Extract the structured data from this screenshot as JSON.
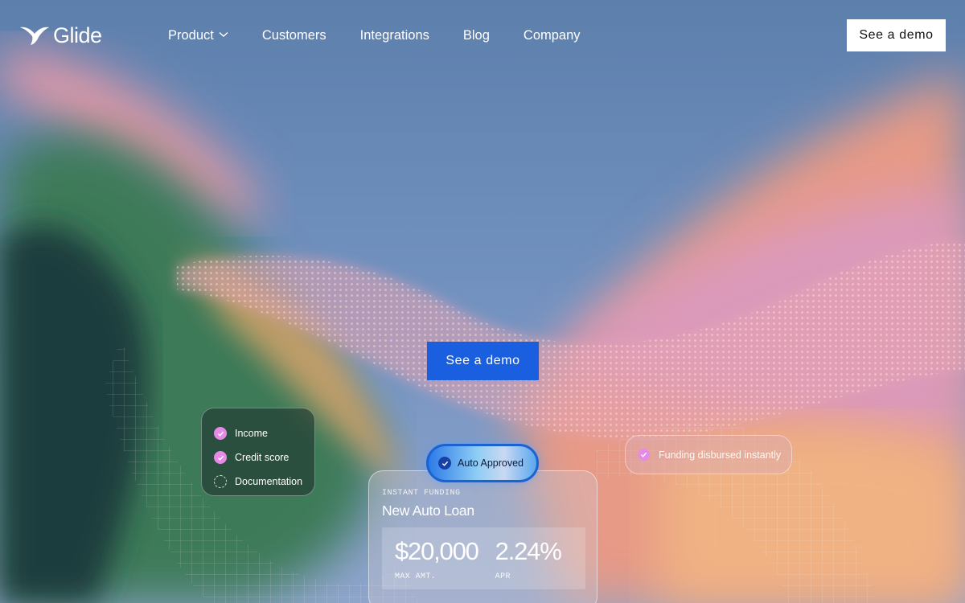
{
  "brand": {
    "name": "Glide",
    "icon": "glide-bird-icon"
  },
  "nav": {
    "links": [
      {
        "label": "Product",
        "has_dropdown": true
      },
      {
        "label": "Customers"
      },
      {
        "label": "Integrations"
      },
      {
        "label": "Blog"
      },
      {
        "label": "Company"
      }
    ],
    "cta_label": "See a demo"
  },
  "hero": {
    "cta_label": "See a demo"
  },
  "checklist": {
    "items": [
      {
        "label": "Income",
        "status": "done"
      },
      {
        "label": "Credit score",
        "status": "done"
      },
      {
        "label": "Documentation",
        "status": "pending"
      }
    ]
  },
  "status_pill": {
    "label": "Auto Approved"
  },
  "toast": {
    "label": "Funding disbursed instantly"
  },
  "loan_card": {
    "eyebrow": "INSTANT FUNDING",
    "title": "New Auto Loan",
    "amount": {
      "value": "$20,000",
      "caption": "MAX AMT."
    },
    "apr": {
      "value": "2.24%",
      "caption": "APR"
    }
  },
  "colors": {
    "primary_button": "#1a5fe0",
    "check_pink": "#e58ae6",
    "pill_check": "#1841a6"
  }
}
